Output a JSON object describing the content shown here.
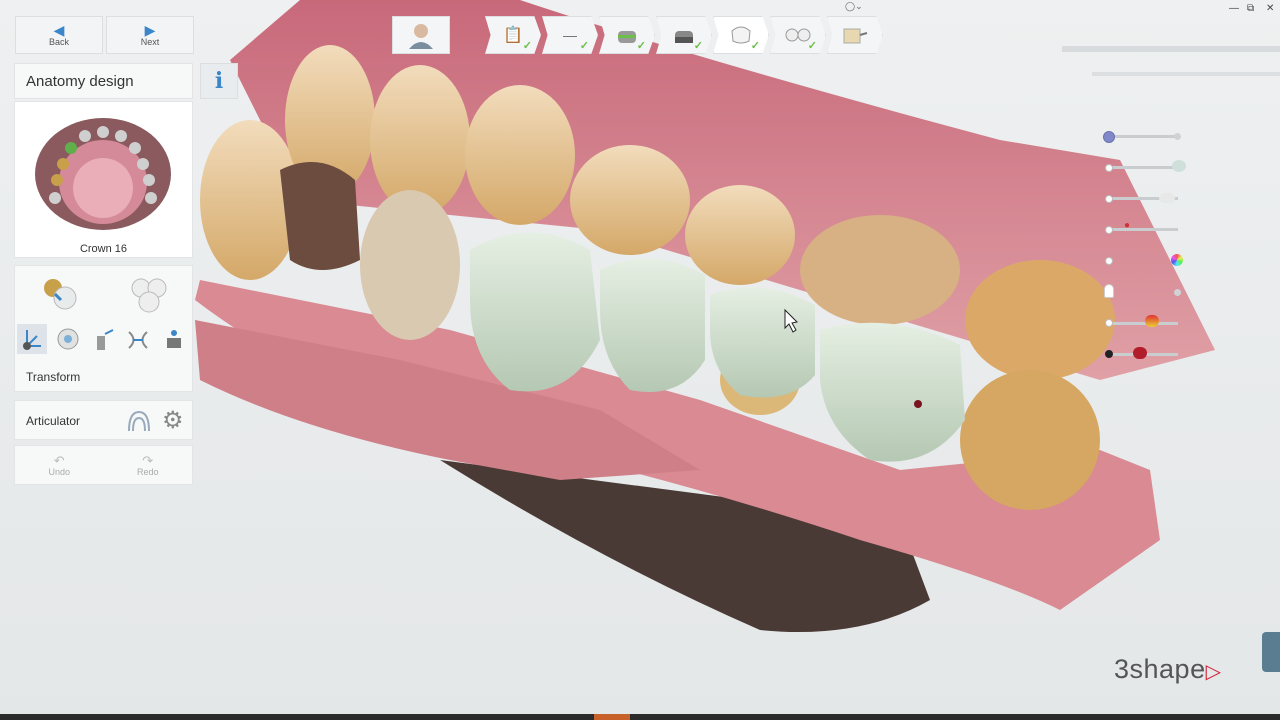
{
  "nav": {
    "back_label": "Back",
    "next_label": "Next"
  },
  "panel": {
    "title": "Anatomy design",
    "info_label": "i",
    "thumb_label": "Crown 16",
    "tool_section_label": "Transform",
    "articulator_label": "Articulator",
    "undo_label": "Undo",
    "redo_label": "Redo"
  },
  "workflow_steps": [
    {
      "icon": "order-form-icon",
      "done": true
    },
    {
      "icon": "scan-tool-icon",
      "done": true
    },
    {
      "icon": "margin-line-icon",
      "done": true
    },
    {
      "icon": "die-icon",
      "done": true
    },
    {
      "icon": "crown-icon",
      "done": true,
      "active": true
    },
    {
      "icon": "bridge-icon",
      "done": true
    },
    {
      "icon": "export-icon",
      "done": false
    }
  ],
  "brand": {
    "logo_text": "3shape",
    "accent": "#d3233b"
  },
  "colors": {
    "accent_blue": "#3a86c8",
    "check_green": "#6cc04a"
  }
}
